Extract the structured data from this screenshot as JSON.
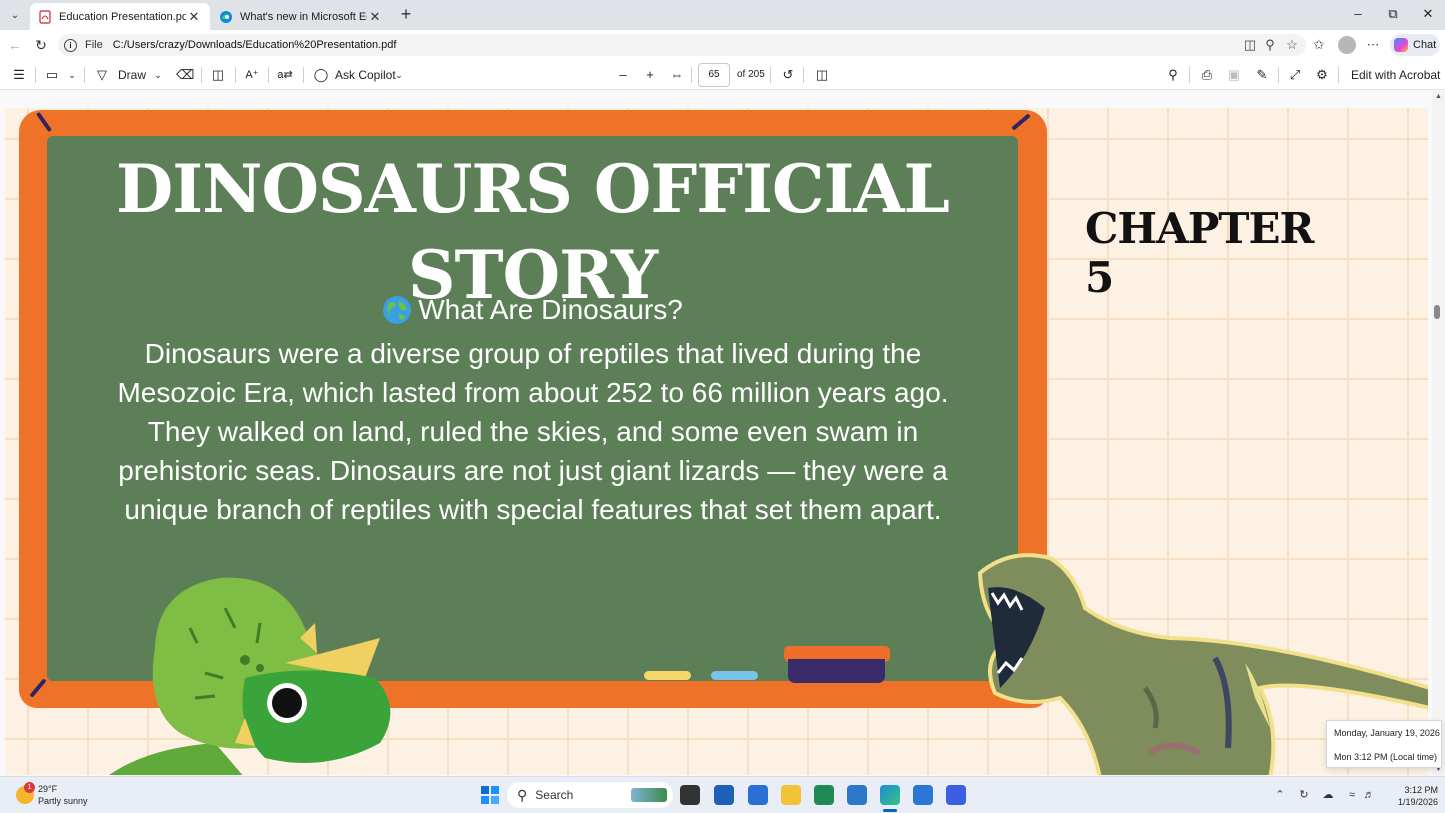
{
  "browser": {
    "tabs": [
      {
        "title": "Education Presentation.pdf",
        "active": true
      },
      {
        "title": "What's new in Microsoft Edge",
        "active": false
      }
    ],
    "address": {
      "scheme": "File",
      "url": "C:/Users/crazy/Downloads/Education%20Presentation.pdf"
    },
    "chat_label": "Chat"
  },
  "pdf_toolbar": {
    "draw_label": "Draw",
    "ask_copilot_label": "Ask Copilot",
    "page_number": "65",
    "page_total": "of 205",
    "edit_acrobat_label": "Edit with Acrobat"
  },
  "slide": {
    "title": "DINOSAURS OFFICIAL STORY",
    "chapter": "CHAPTER 5",
    "question": "What Are Dinosaurs?",
    "body": "Dinosaurs were a diverse group of reptiles that lived during the Mesozoic Era, which lasted from about 252 to 66 million years ago. They walked on land, ruled the skies, and some even swam in prehistoric seas. Dinosaurs are not just giant lizards — they were a unique branch of reptiles with special features that set them apart."
  },
  "tooltip": {
    "date": "Monday, January 19, 2026",
    "time": "Mon 3:12 PM (Local time)"
  },
  "taskbar": {
    "weather_temp": "29°F",
    "weather_desc": "Partly sunny",
    "weather_badge": "1",
    "search_placeholder": "Search",
    "clock_time": "3:12 PM",
    "clock_date": "1/19/2026"
  },
  "colors": {
    "board": "#5c7f58",
    "frame": "#ee7328",
    "page_bg": "#fdf1e3",
    "accent": "#0067c0"
  }
}
